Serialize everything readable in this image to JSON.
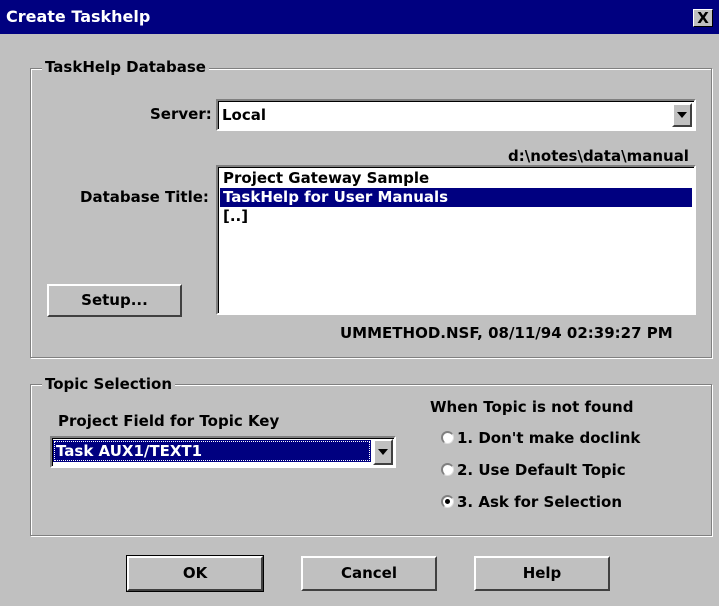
{
  "window": {
    "title": "Create Taskhelp",
    "close_label": "X"
  },
  "database_group": {
    "legend": "TaskHelp Database",
    "server_label": "Server:",
    "server_value": "Local",
    "path": "d:\\notes\\data\\manual",
    "db_title_label": "Database Title:",
    "db_items": [
      "Project Gateway Sample",
      "TaskHelp for User Manuals",
      "[..]"
    ],
    "selected_index": 1,
    "file_info": "UMMETHOD.NSF, 08/11/94 02:39:27 PM",
    "setup_button": "Setup..."
  },
  "topic_group": {
    "legend": "Topic Selection",
    "field_label": "Project Field for Topic Key",
    "field_value": "Task AUX1/TEXT1",
    "not_found_label": "When Topic is not found",
    "options": [
      "1. Don't make doclink",
      "2. Use Default Topic",
      "3. Ask for Selection"
    ],
    "selected_option": 2
  },
  "buttons": {
    "ok": "OK",
    "cancel": "Cancel",
    "help": "Help"
  },
  "colors": {
    "face": "#c0c0c0",
    "titlebar": "#000080",
    "selection": "#000080"
  },
  "icons": {
    "close": "close-icon",
    "dropdown": "chevron-down-icon"
  }
}
